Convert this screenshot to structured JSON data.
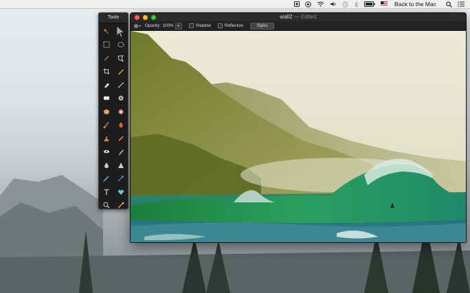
{
  "menubar": {
    "user_name": "Back to the Mac"
  },
  "tools_panel": {
    "title": "Tools"
  },
  "window": {
    "title": "wall2",
    "title_separator": "—",
    "edited_label": "Edited"
  },
  "options_bar": {
    "opacity_label": "Opacity:",
    "opacity_value": "100%",
    "shadow_label": "Shadow",
    "reflection_label": "Reflection",
    "styles_button": "Styles"
  }
}
